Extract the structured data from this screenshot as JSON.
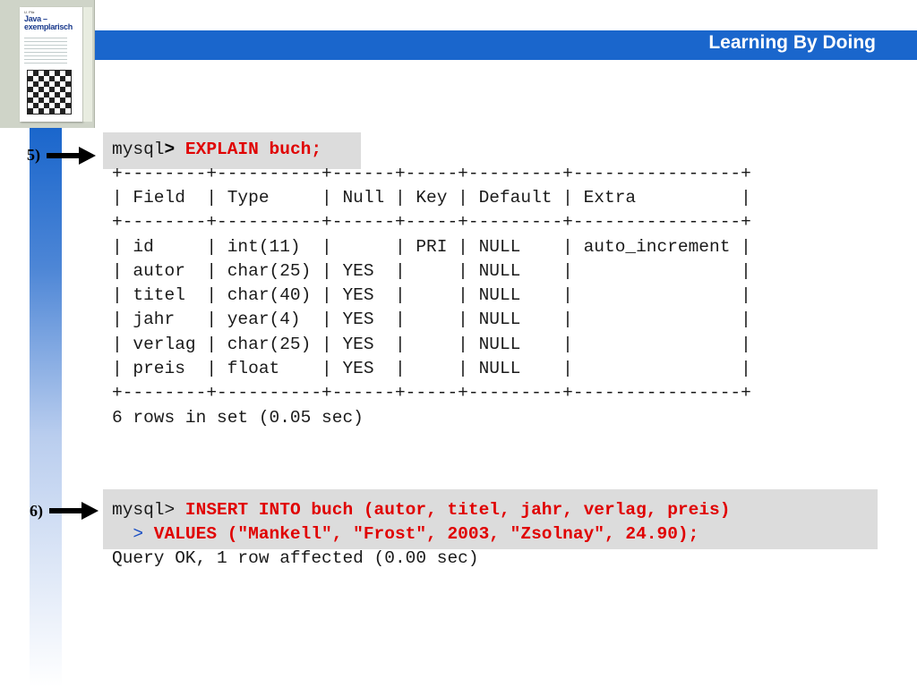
{
  "header": {
    "title": "Learning By Doing"
  },
  "book": {
    "author": "U. Pilz",
    "title_line1": "Java –",
    "title_line2": "exemplarisch"
  },
  "step5": {
    "label": "5)",
    "prompt": "mysql",
    "prompt_gt": ">",
    "command": " EXPLAIN buch;",
    "table_lines": [
      "+--------+----------+------+-----+---------+----------------+",
      "| Field  | Type     | Null | Key | Default | Extra          |",
      "+--------+----------+------+-----+---------+----------------+",
      "| id     | int(11)  |      | PRI | NULL    | auto_increment |",
      "| autor  | char(25) | YES  |     | NULL    |                |",
      "| titel  | char(40) | YES  |     | NULL    |                |",
      "| jahr   | year(4)  | YES  |     | NULL    |                |",
      "| verlag | char(25) | YES  |     | NULL    |                |",
      "| preis  | float    | YES  |     | NULL    |                |",
      "+--------+----------+------+-----+---------+----------------+"
    ],
    "result": "6 rows in set (0.05 sec)"
  },
  "step6": {
    "label": "6)",
    "prompt": "mysql>",
    "command_line1": " INSERT INTO buch (autor, titel, jahr, verlag, preis)",
    "cont_prompt": "  >",
    "command_line2": " VALUES (\"Mankell\", \"Frost\", 2003, \"Zsolnay\", 24.90);",
    "result": "Query OK, 1 row affected (0.00 sec)"
  },
  "colors": {
    "accent_blue": "#1a66cc",
    "command_red": "#e00000",
    "box_gray": "#dcdcdc"
  }
}
